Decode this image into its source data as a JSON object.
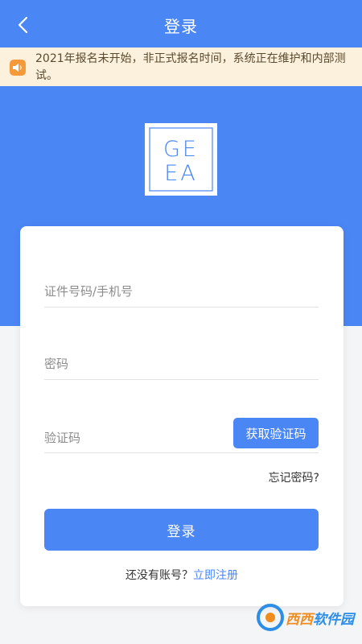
{
  "header": {
    "title": "登录",
    "back_icon": "chevron-left-icon"
  },
  "notice": {
    "icon": "speaker-icon",
    "text": "2021年报名未开始，非正式报名时间，系统正在维护和内部测试。"
  },
  "logo": {
    "lines": [
      "GE",
      "EA"
    ]
  },
  "form": {
    "id_placeholder": "证件号码/手机号",
    "password_placeholder": "密码",
    "code_placeholder": "验证码",
    "get_code_label": "获取验证码",
    "forgot_label": "忘记密码?",
    "login_label": "登录",
    "no_account_text": "还没有账号？",
    "register_label": "立即注册"
  },
  "watermark": {
    "text_a": "西西",
    "text_b": "软件园"
  },
  "colors": {
    "primary": "#4b86f5",
    "notice_bg": "#fcf1dc",
    "notice_icon": "#f59a3b"
  }
}
